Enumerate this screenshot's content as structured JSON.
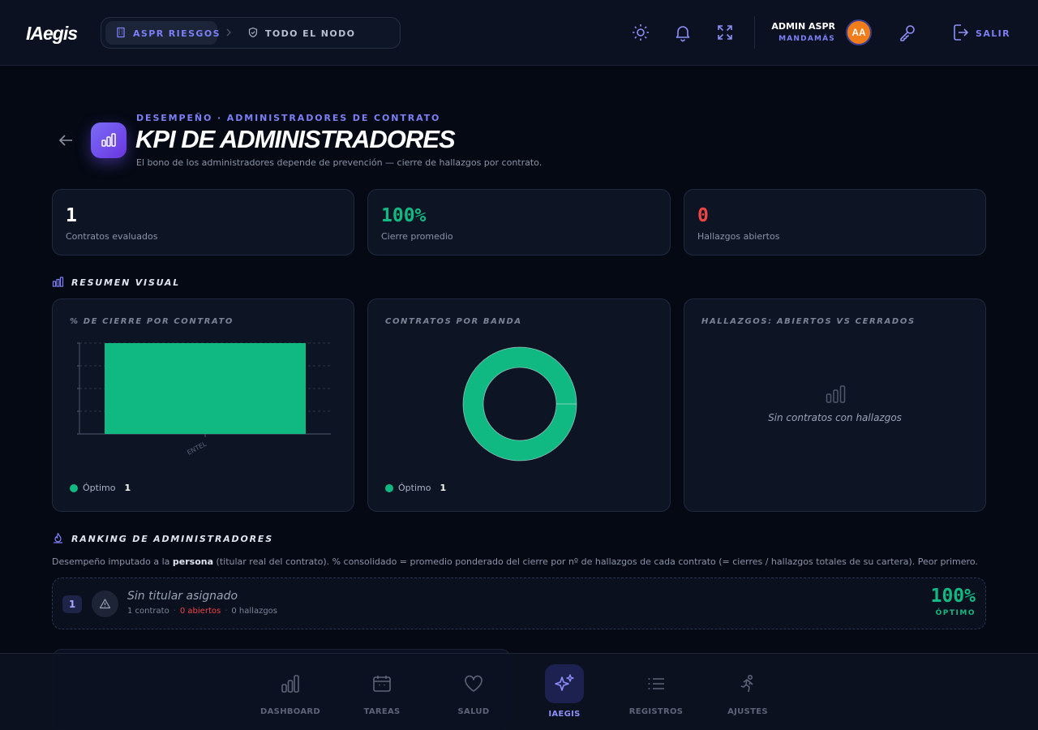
{
  "topbar": {
    "logo": "IAegis",
    "breadcrumb": [
      "ASPR RIESGOS",
      "TODO EL NODO"
    ],
    "user_name": "ADMIN ASPR",
    "user_role": "MANDAMÁS",
    "avatar_initials": "AA",
    "logout_label": "SALIR",
    "accent_color": "#7c7ff6",
    "icons": [
      "building-icon",
      "chevron-right-icon",
      "shield-icon",
      "sun-icon",
      "bell-icon",
      "expand-icon",
      "key-icon",
      "logout-icon"
    ]
  },
  "header": {
    "eyebrow": "DESEMPEÑO · ADMINISTRADORES DE CONTRATO",
    "title": "KPI DE ADMINISTRADORES",
    "subtitle": "El bono de los administradores depende de prevención — cierre de hallazgos por contrato."
  },
  "stats": [
    {
      "value": "1",
      "label": "Contratos evaluados",
      "color": "#ffffff"
    },
    {
      "value": "100%",
      "label": "Cierre promedio",
      "color": "#10b981"
    },
    {
      "value": "0",
      "label": "Hallazgos abiertos",
      "color": "#ef4444"
    }
  ],
  "visual_summary": {
    "section_title": "RESUMEN VISUAL",
    "charts": {
      "closure": {
        "title": "% DE CIERRE POR CONTRATO",
        "legend_label": "Óptimo",
        "legend_count": "1"
      },
      "bands": {
        "title": "CONTRATOS POR BANDA",
        "legend_label": "Óptimo",
        "legend_count": "1"
      },
      "findings": {
        "title": "HALLAZGOS: ABIERTOS VS CERRADOS",
        "empty_text": "Sin contratos con hallazgos"
      }
    }
  },
  "chart_data": [
    {
      "type": "bar",
      "title": "% DE CIERRE POR CONTRATO",
      "categories": [
        "ENTEL"
      ],
      "values": [
        100
      ],
      "ylim": [
        0,
        100
      ],
      "grid": true,
      "color": "#10b981"
    },
    {
      "type": "pie",
      "title": "CONTRATOS POR BANDA",
      "labels": [
        "Óptimo"
      ],
      "values": [
        1
      ],
      "color": "#10b981"
    }
  ],
  "ranking": {
    "section_title": "RANKING DE ADMINISTRADORES",
    "desc_before": "Desempeño imputado a la ",
    "desc_bold": "persona",
    "desc_after": " (titular real del contrato). % consolidado = promedio ponderado del cierre por nº de hallazgos de cada contrato (= cierres / hallazgos totales de su cartera). Peor primero.",
    "rows": [
      {
        "rank": "1",
        "name": "Sin titular asignado",
        "contracts": "1 contrato",
        "open": "0 abiertos",
        "findings": "0 hallazgos",
        "pct": "100%",
        "band": "ÓPTIMO"
      }
    ]
  },
  "bottom_nav": [
    {
      "label": "DASHBOARD",
      "icon": "chart-icon"
    },
    {
      "label": "TAREAS",
      "icon": "calendar-icon"
    },
    {
      "label": "SALUD",
      "icon": "heart-icon"
    },
    {
      "label": "IAEGIS",
      "icon": "sparkles-icon",
      "active": true
    },
    {
      "label": "REGISTROS",
      "icon": "list-icon"
    },
    {
      "label": "AJUSTES",
      "icon": "runner-icon"
    }
  ]
}
